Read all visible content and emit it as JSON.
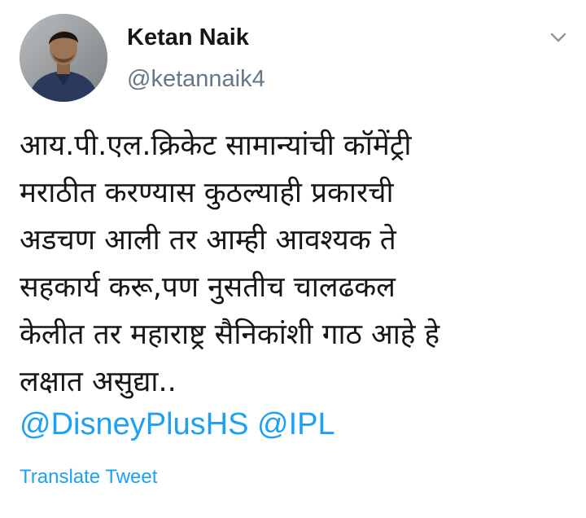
{
  "author": {
    "name": "Ketan Naik",
    "handle": "@ketannaik4",
    "avatar_icon": "profile-photo"
  },
  "menu": {
    "icon": "chevron-down-icon"
  },
  "tweet": {
    "lines": [
      "आय.पी.एल.क्रिकेट सामान्यांची कॉमेंट्री",
      "मराठीत करण्यास कुठल्याही प्रकारची",
      "अडचण आली तर आम्ही आवश्यक ते",
      "सहकार्य करू,पण नुसतीच चालढकल",
      "केलीत तर महाराष्ट्र सैनिकांशी गाठ आहे हे",
      "लक्षात असुद्या.."
    ],
    "mentions": [
      "@DisneyPlusHS",
      "@IPL"
    ]
  },
  "translate_label": "Translate Tweet",
  "colors": {
    "link": "#1da1f2",
    "secondary_text": "#657786",
    "primary_text": "#14171a"
  }
}
